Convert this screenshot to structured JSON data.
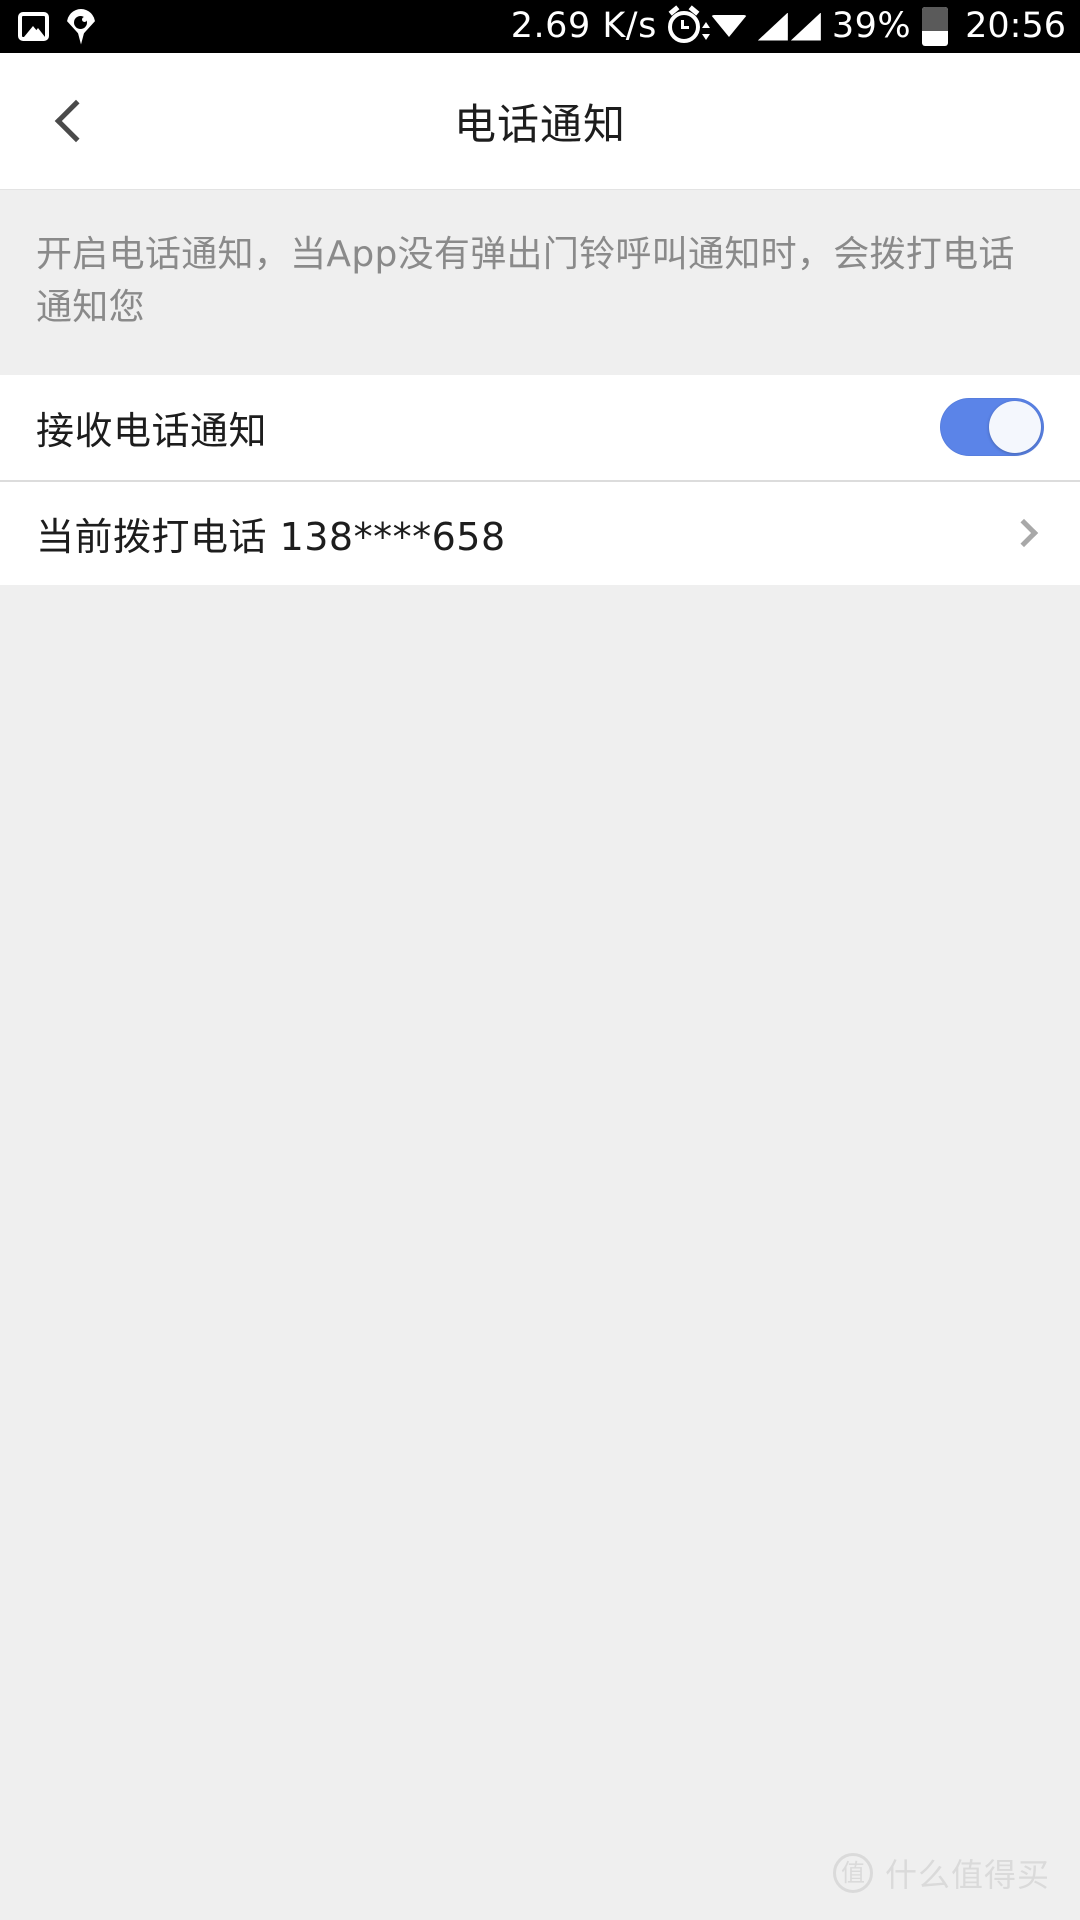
{
  "status_bar": {
    "network_speed": "2.69 K/s",
    "battery_percent": "39%",
    "clock": "20:56",
    "icons": {
      "gallery": "image-icon",
      "location": "location-pin-icon",
      "alarm": "alarm-clock-icon",
      "wifi": "wifi-icon",
      "signal_1": "signal-bars-icon",
      "signal_2": "signal-bars-icon",
      "battery": "battery-icon"
    }
  },
  "nav": {
    "back_icon": "chevron-left-icon",
    "title": "电话通知"
  },
  "description": {
    "text": "开启电话通知，当App没有弹出门铃呼叫通知时，会拨打电话通知您"
  },
  "settings": {
    "rows": [
      {
        "label": "接收电话通知",
        "type": "toggle",
        "value": "on"
      },
      {
        "label": "当前拨打电话 138****658",
        "type": "link",
        "accessory": "chevron-right-icon"
      }
    ]
  },
  "colors": {
    "toggle_on": "#5b84e8",
    "toggle_knob": "#f4f7fd",
    "page_background": "#efefef",
    "card_background": "#ffffff",
    "title_text": "#1d1d1d",
    "description_text": "#8a8a8a"
  },
  "watermark": {
    "logo_char": "值",
    "text": "什么值得买"
  }
}
